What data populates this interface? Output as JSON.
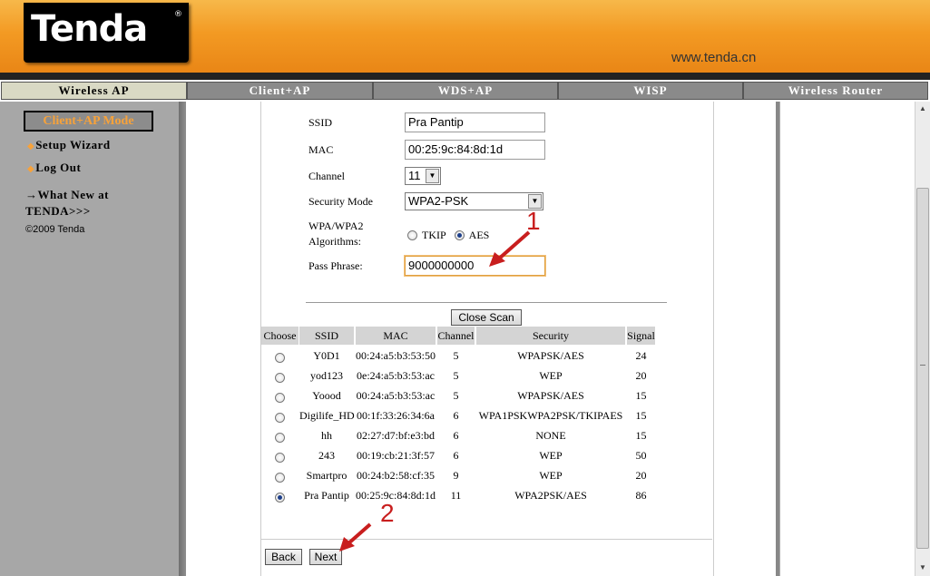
{
  "header": {
    "logo_text": "Tenda",
    "logo_mark": "®",
    "url": "www.tenda.cn"
  },
  "tabs": [
    {
      "label": "Wireless AP",
      "active": true
    },
    {
      "label": "Client+AP",
      "active": false
    },
    {
      "label": "WDS+AP",
      "active": false
    },
    {
      "label": "WISP",
      "active": false
    },
    {
      "label": "Wireless Router",
      "active": false
    }
  ],
  "sidebar": {
    "mode_button": "Client+AP Mode",
    "setup_wizard": "Setup Wizard",
    "logout": "Log Out",
    "whats_new_line1": "→What New at",
    "whats_new_line2": "TENDA>>>",
    "copyright": "©2009 Tenda"
  },
  "form": {
    "ssid_label": "SSID",
    "ssid_value": "Pra Pantip",
    "mac_label": "MAC",
    "mac_value": "00:25:9c:84:8d:1d",
    "channel_label": "Channel",
    "channel_value": "11",
    "security_label": "Security Mode",
    "security_value": "WPA2-PSK",
    "algo_label_line1": "WPA/WPA2",
    "algo_label_line2": "Algorithms:",
    "algo_tkip": "TKIP",
    "algo_aes": "AES",
    "algo_selected": "AES",
    "passphrase_label": "Pass Phrase:",
    "passphrase_value": "9000000000"
  },
  "scan": {
    "close_button": "Close Scan",
    "columns": [
      "Choose",
      "SSID",
      "MAC",
      "Channel",
      "Security",
      "Signal"
    ],
    "rows": [
      {
        "ssid": "Y0D1",
        "mac": "00:24:a5:b3:53:50",
        "channel": "5",
        "security": "WPAPSK/AES",
        "signal": "24",
        "selected": false
      },
      {
        "ssid": "yod123",
        "mac": "0e:24:a5:b3:53:ac",
        "channel": "5",
        "security": "WEP",
        "signal": "20",
        "selected": false
      },
      {
        "ssid": "Yoood",
        "mac": "00:24:a5:b3:53:ac",
        "channel": "5",
        "security": "WPAPSK/AES",
        "signal": "15",
        "selected": false
      },
      {
        "ssid": "Digilife_HD",
        "mac": "00:1f:33:26:34:6a",
        "channel": "6",
        "security": "WPA1PSKWPA2PSK/TKIPAES",
        "signal": "15",
        "selected": false
      },
      {
        "ssid": "hh",
        "mac": "02:27:d7:bf:e3:bd",
        "channel": "6",
        "security": "NONE",
        "signal": "15",
        "selected": false
      },
      {
        "ssid": "243",
        "mac": "00:19:cb:21:3f:57",
        "channel": "6",
        "security": "WEP",
        "signal": "50",
        "selected": false
      },
      {
        "ssid": "Smartpro",
        "mac": "00:24:b2:58:cf:35",
        "channel": "9",
        "security": "WEP",
        "signal": "20",
        "selected": false
      },
      {
        "ssid": "Pra Pantip",
        "mac": "00:25:9c:84:8d:1d",
        "channel": "11",
        "security": "WPA2PSK/AES",
        "signal": "86",
        "selected": true
      }
    ]
  },
  "buttons": {
    "back": "Back",
    "next": "Next"
  },
  "annotations": {
    "one": "1",
    "two": "2"
  },
  "colors": {
    "accent_orange": "#f39a23",
    "annotation_red": "#c81e1e",
    "mode_text": "#f7a23a"
  }
}
